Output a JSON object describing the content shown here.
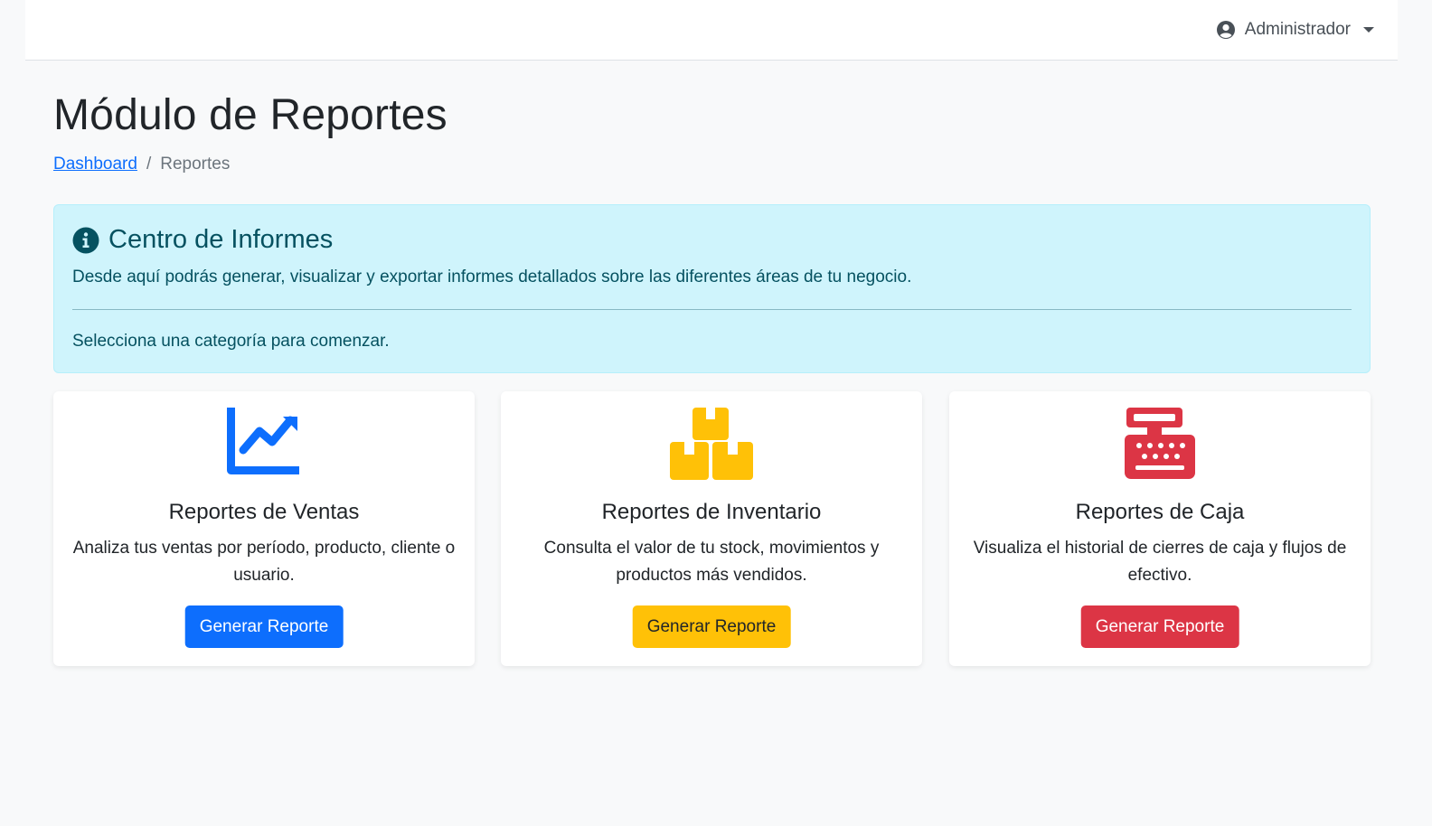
{
  "header": {
    "user_label": "Administrador"
  },
  "page": {
    "title": "Módulo de Reportes",
    "breadcrumb": {
      "home": "Dashboard",
      "separator": "/",
      "current": "Reportes"
    }
  },
  "alert": {
    "icon": "info-circle-icon",
    "heading": "Centro de Informes",
    "text1": "Desde aquí podrás generar, visualizar y exportar informes detallados sobre las diferentes áreas de tu negocio.",
    "text2": "Selecciona una categoría para comenzar."
  },
  "cards": [
    {
      "icon": "chart-line-icon",
      "color": "#0d6efd",
      "title": "Reportes de Ventas",
      "text": "Analiza tus ventas por período, producto, cliente o usuario.",
      "button": "Generar Reporte"
    },
    {
      "icon": "boxes-icon",
      "color": "#ffc107",
      "title": "Reportes de Inventario",
      "text": "Consulta el valor de tu stock, movimientos y productos más vendidos.",
      "button": "Generar Reporte"
    },
    {
      "icon": "cash-register-icon",
      "color": "#dc3545",
      "title": "Reportes de Caja",
      "text": "Visualiza el historial de cierres de caja y flujos de efectivo.",
      "button": "Generar Reporte"
    }
  ]
}
